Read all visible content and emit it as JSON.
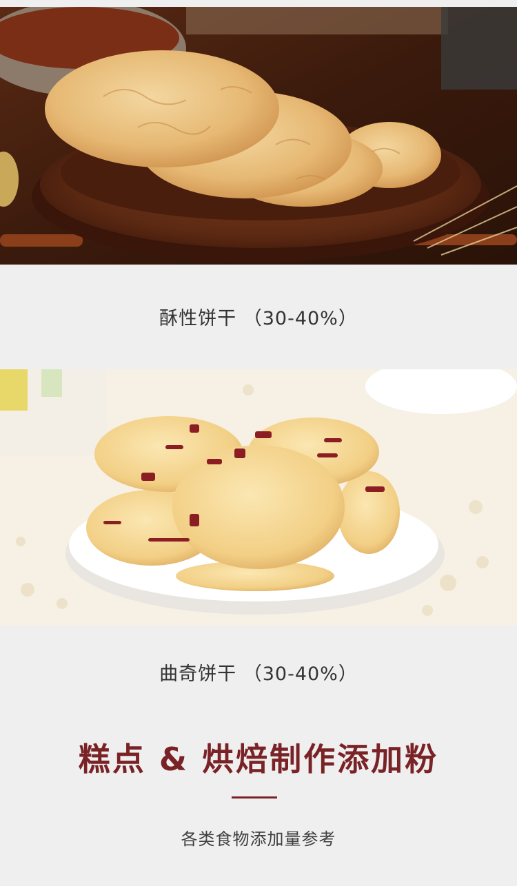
{
  "sections": [
    {
      "photo_name": "shortbread-biscuit-photo",
      "caption": "酥性饼干 （30-40%）"
    },
    {
      "photo_name": "cookie-photo",
      "caption": "曲奇饼干 （30-40%）"
    }
  ],
  "heading": "糕点 & 烘焙制作添加粉",
  "subheading": "各类食物添加量参考",
  "colors": {
    "background": "#efefef",
    "accent": "#7a2327",
    "caption_text": "#333333"
  }
}
